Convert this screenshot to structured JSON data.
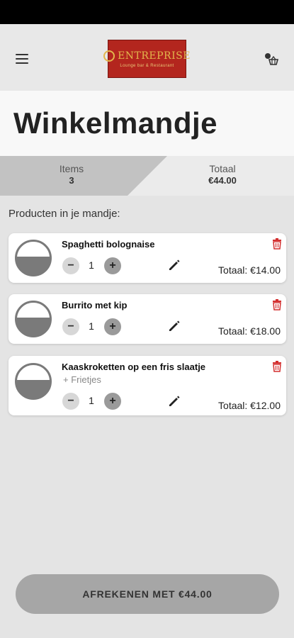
{
  "header": {
    "logo_text": "ENTREPRISE",
    "logo_sub": "Lounge bar & Restaurant"
  },
  "page": {
    "title": "Winkelmandje"
  },
  "summary": {
    "items_label": "Items",
    "items_value": "3",
    "total_label": "Totaal",
    "total_value": "€44.00"
  },
  "products_heading": "Producten in je mandje:",
  "cart": [
    {
      "name": "Spaghetti bolognaise",
      "extra": "",
      "qty": "1",
      "total": "Totaal: €14.00"
    },
    {
      "name": "Burrito met kip",
      "extra": "",
      "qty": "1",
      "total": "Totaal: €18.00"
    },
    {
      "name": "Kaaskroketten op een fris slaatje",
      "extra": "+ Frietjes",
      "qty": "1",
      "total": "Totaal: €12.00"
    }
  ],
  "qty_controls": {
    "minus": "−",
    "plus": "+"
  },
  "checkout_label": "AFREKENEN MET €44.00",
  "icons": {
    "menu": "hamburger-menu-icon",
    "account": "user-basket-icon",
    "edit": "pencil-icon",
    "delete": "trash-icon"
  },
  "colors": {
    "brand_red": "#b3261e",
    "brand_gold": "#e2b64c",
    "delete_red": "#d32f2f"
  }
}
